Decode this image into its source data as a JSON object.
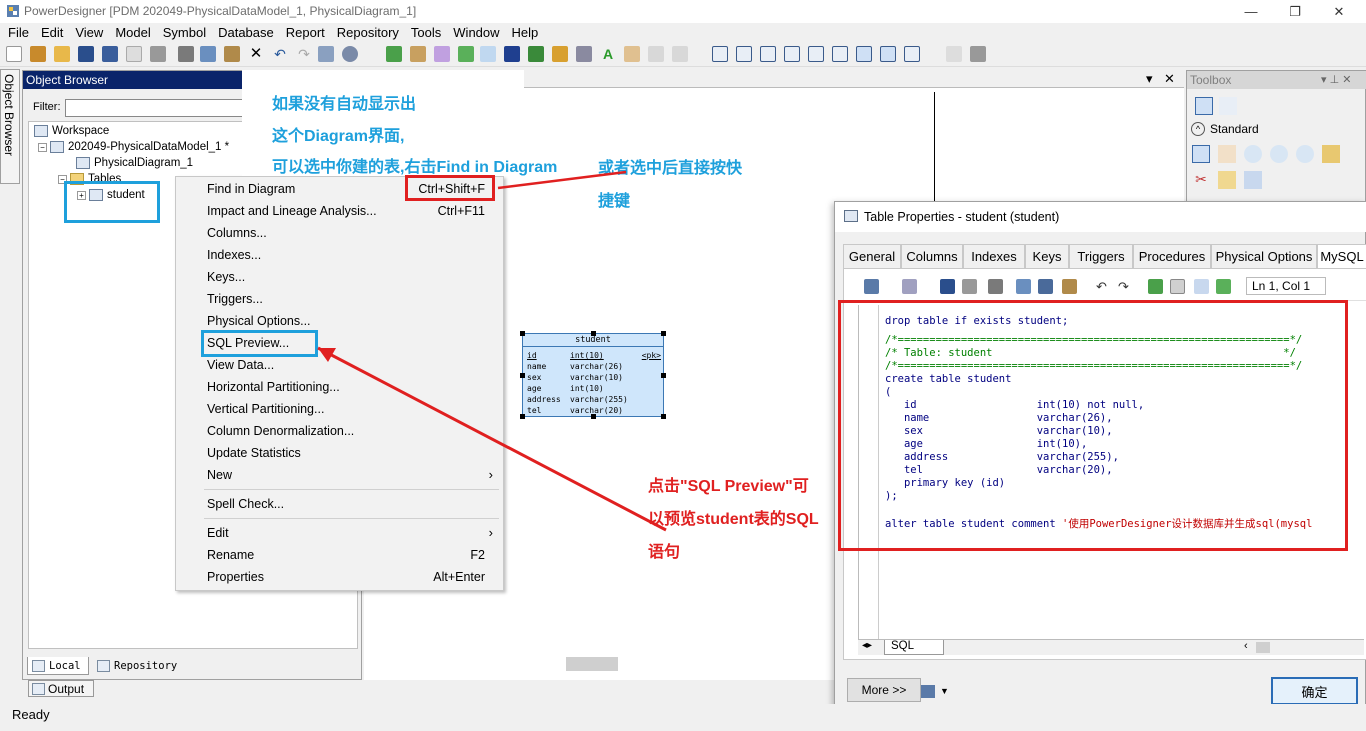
{
  "window": {
    "title": "PowerDesigner [PDM 202049-PhysicalDataModel_1, PhysicalDiagram_1]",
    "minimize_glyph": "—",
    "maximize_glyph": "❐",
    "close_glyph": "✕"
  },
  "menubar": [
    "File",
    "Edit",
    "View",
    "Model",
    "Symbol",
    "Database",
    "Report",
    "Repository",
    "Tools",
    "Window",
    "Help"
  ],
  "object_browser": {
    "side_tab": "Object Browser",
    "header": "Object Browser",
    "filter_label": "Filter:",
    "filter_value": "",
    "tree": {
      "workspace": "Workspace",
      "model": "202049-PhysicalDataModel_1 *",
      "diagram": "PhysicalDiagram_1",
      "tables_folder": "Tables",
      "table": "student"
    },
    "tabs": {
      "local": "Local",
      "repository": "Repository"
    },
    "output": "Output"
  },
  "context_menu": {
    "items": [
      {
        "label": "Find in Diagram",
        "shortcut": "Ctrl+Shift+F"
      },
      {
        "label": "Impact and Lineage Analysis...",
        "shortcut": "Ctrl+F11"
      },
      {
        "label": "Columns...",
        "shortcut": ""
      },
      {
        "label": "Indexes...",
        "shortcut": ""
      },
      {
        "label": "Keys...",
        "shortcut": ""
      },
      {
        "label": "Triggers...",
        "shortcut": ""
      },
      {
        "label": "Physical Options...",
        "shortcut": ""
      },
      {
        "label": "SQL Preview...",
        "shortcut": ""
      },
      {
        "label": "View Data...",
        "shortcut": ""
      },
      {
        "label": "Horizontal Partitioning...",
        "shortcut": ""
      },
      {
        "label": "Vertical Partitioning...",
        "shortcut": ""
      },
      {
        "label": "Column Denormalization...",
        "shortcut": ""
      },
      {
        "label": "Update Statistics",
        "shortcut": ""
      },
      {
        "label": "New",
        "shortcut": ""
      },
      {
        "label": "Spell Check...",
        "shortcut": ""
      },
      {
        "label": "Edit",
        "shortcut": ""
      },
      {
        "label": "Rename",
        "shortcut": "F2"
      },
      {
        "label": "Properties",
        "shortcut": "Alt+Enter"
      }
    ],
    "submenu_arrow": "›"
  },
  "entity": {
    "name": "student",
    "columns": [
      {
        "name": "id",
        "type": "int(10)",
        "key": "<pk>"
      },
      {
        "name": "name",
        "type": "varchar(26)",
        "key": ""
      },
      {
        "name": "sex",
        "type": "varchar(10)",
        "key": ""
      },
      {
        "name": "age",
        "type": "int(10)",
        "key": ""
      },
      {
        "name": "address",
        "type": "varchar(255)",
        "key": ""
      },
      {
        "name": "tel",
        "type": "varchar(20)",
        "key": ""
      }
    ]
  },
  "diagram_tabbar": {
    "dropdown": "▾",
    "close": "✕"
  },
  "toolbox": {
    "header": "Toolbox",
    "pin": "▾ ⊥ ✕",
    "section": "Standard"
  },
  "dialog": {
    "title": "Table Properties - student (student)",
    "tabs": [
      "General",
      "Columns",
      "Indexes",
      "Keys",
      "Triggers",
      "Procedures",
      "Physical Options",
      "MySQL"
    ],
    "cursor_status": "Ln 1, Col 1",
    "code_lines": [
      {
        "text": "drop table if exists student;",
        "kind": "code"
      },
      {
        "text": "",
        "kind": "code"
      },
      {
        "text": "/*==============================================================*/",
        "kind": "cmt"
      },
      {
        "text": "/* Table: student                                              */",
        "kind": "cmt"
      },
      {
        "text": "/*==============================================================*/",
        "kind": "cmt"
      },
      {
        "text": "create table student",
        "kind": "code"
      },
      {
        "text": "(",
        "kind": "code"
      },
      {
        "text": "   id                   int(10) not null,",
        "kind": "code"
      },
      {
        "text": "   name                 varchar(26),",
        "kind": "code"
      },
      {
        "text": "   sex                  varchar(10),",
        "kind": "code"
      },
      {
        "text": "   age                  int(10),",
        "kind": "code"
      },
      {
        "text": "   address              varchar(255),",
        "kind": "code"
      },
      {
        "text": "   tel                  varchar(20),",
        "kind": "code"
      },
      {
        "text": "   primary key (id)",
        "kind": "code"
      },
      {
        "text": ");",
        "kind": "code"
      },
      {
        "text": "",
        "kind": "code"
      }
    ],
    "alter_prefix": "alter table student comment ",
    "alter_string": "'使用PowerDesigner设计数据库并生成sql(mysql",
    "sql_tab": "SQL",
    "more_button": "More >>",
    "ok_button": "确定"
  },
  "statusbar": {
    "text": "Ready"
  },
  "annotations": {
    "callout_lines": [
      "如果没有自动显示出",
      "这个Diagram界面,",
      "可以选中你建的表,右击Find in Diagram"
    ],
    "shortcut_note_lines": [
      "或者选中后直接按快",
      "捷键"
    ],
    "sql_note_lines": [
      "点击\"SQL Preview\"可",
      "以预览student表的SQL",
      "语句"
    ]
  },
  "colors": {
    "annotation_blue": "#1ea0dc",
    "annotation_red": "#e02020",
    "browser_header": "#0a246a",
    "entity_fill": "#cfe6fb"
  }
}
